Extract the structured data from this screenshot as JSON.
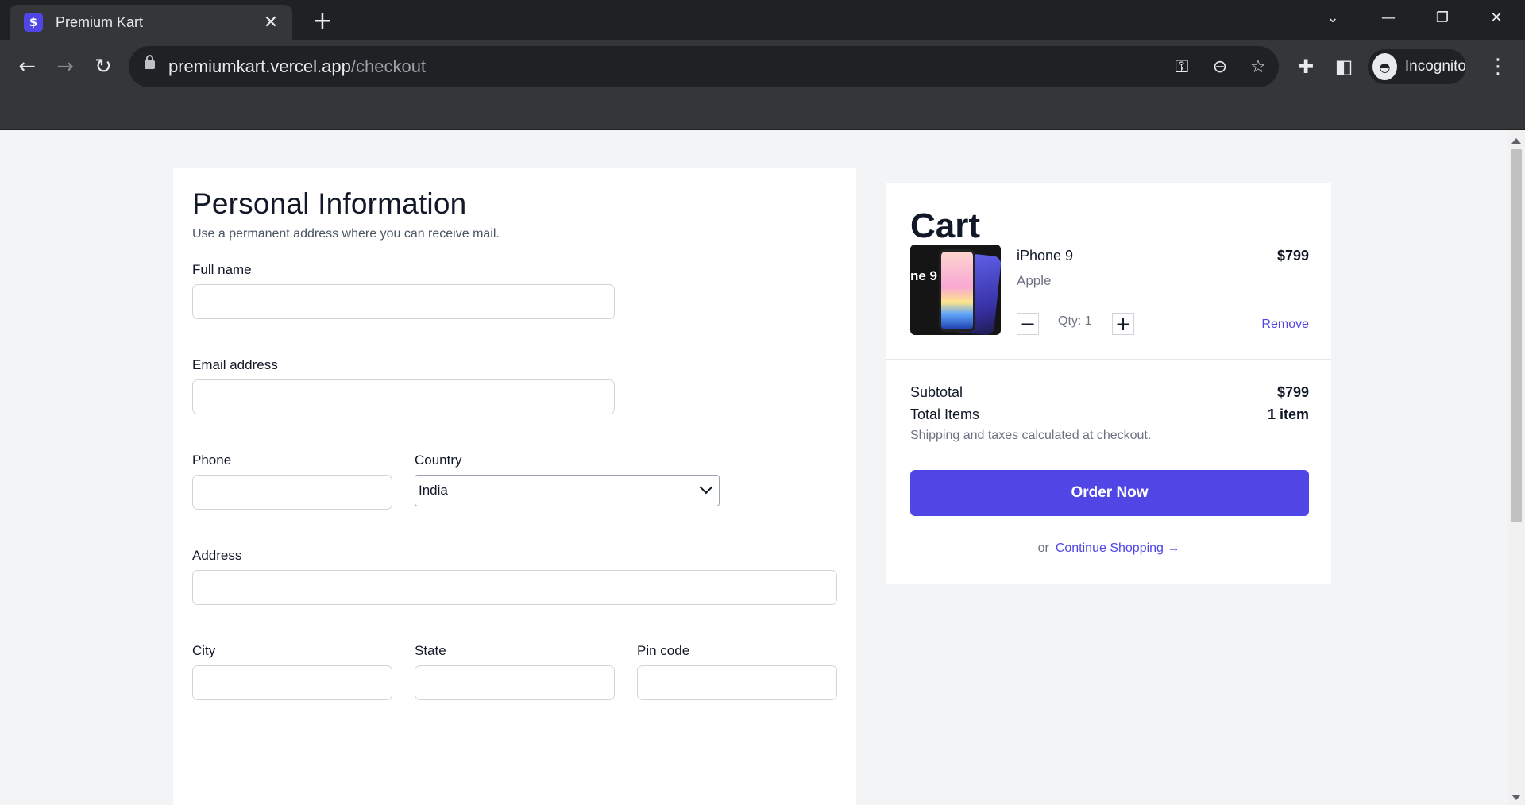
{
  "browser": {
    "tab_title": "Premium Kart",
    "tab_favicon": "$",
    "url_host": "premiumkart.vercel.app",
    "url_path": "/checkout",
    "profile_label": "Incognito"
  },
  "icons": {
    "back": "back-arrow-icon",
    "forward": "forward-arrow-icon",
    "reload": "reload-icon",
    "key": "key-icon",
    "zoom": "zoom-out-icon",
    "bookmark": "star-icon",
    "extensions": "puzzle-icon",
    "sidepanel": "side-panel-icon",
    "menu": "kebab-menu-icon"
  },
  "form": {
    "title": "Personal Information",
    "subtitle": "Use a permanent address where you can receive mail.",
    "full_name_label": "Full name",
    "email_label": "Email address",
    "phone_label": "Phone",
    "country_label": "Country",
    "country_value": "India",
    "address_label": "Address",
    "city_label": "City",
    "state_label": "State",
    "pincode_label": "Pin code"
  },
  "cart": {
    "title": "Cart",
    "item": {
      "image_text": "ne 9",
      "name": "iPhone 9",
      "brand": "Apple",
      "price": "$799",
      "qty_label": "Qty: 1",
      "remove_label": "Remove"
    },
    "subtotal_label": "Subtotal",
    "subtotal_value": "$799",
    "total_items_label": "Total Items",
    "total_items_value": "1 item",
    "shipping_note": "Shipping and taxes calculated at checkout.",
    "order_button": "Order Now",
    "or_text": "or",
    "continue_link": "Continue Shopping →"
  },
  "colors": {
    "accent": "#4f46e5",
    "chrome_dark": "#202124",
    "chrome_toolbar": "#35363a",
    "page_bg": "#f3f4f6"
  }
}
